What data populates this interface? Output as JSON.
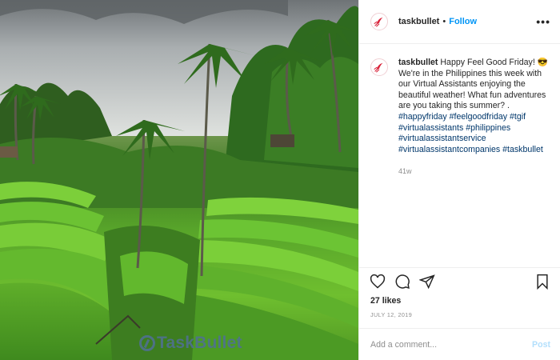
{
  "photo": {
    "alt": "Rice terraces with palm trees",
    "watermark_text": "TaskBullet"
  },
  "header": {
    "username": "taskbullet",
    "separator": "•",
    "follow_label": "Follow",
    "more_label": "•••"
  },
  "caption": {
    "username": "taskbullet",
    "text": "Happy Feel Good Friday! 😎 We're in the Philippines this week with our Virtual Assistants enjoying the beautiful weather! What fun adventures are you taking this summer? .",
    "hashtags": [
      "#happyfriday",
      "#feelgoodfriday",
      "#tgif",
      "#virtualassistants",
      "#philippines",
      "#virtualassistantservice",
      "#virtualassistantcompanies",
      "#taskbullet"
    ],
    "age": "41w"
  },
  "actions": {
    "like_icon": "heart-icon",
    "comment_icon": "comment-icon",
    "share_icon": "paper-plane-icon",
    "save_icon": "bookmark-icon"
  },
  "likes": "27 likes",
  "date": "JULY 12, 2019",
  "comment": {
    "placeholder": "Add a comment...",
    "post_label": "Post"
  },
  "colors": {
    "brand": "#d9233a",
    "link": "#0095f6",
    "hashtag": "#00376b",
    "muted": "#8e8e8e",
    "post_disabled": "#b2dffc"
  }
}
